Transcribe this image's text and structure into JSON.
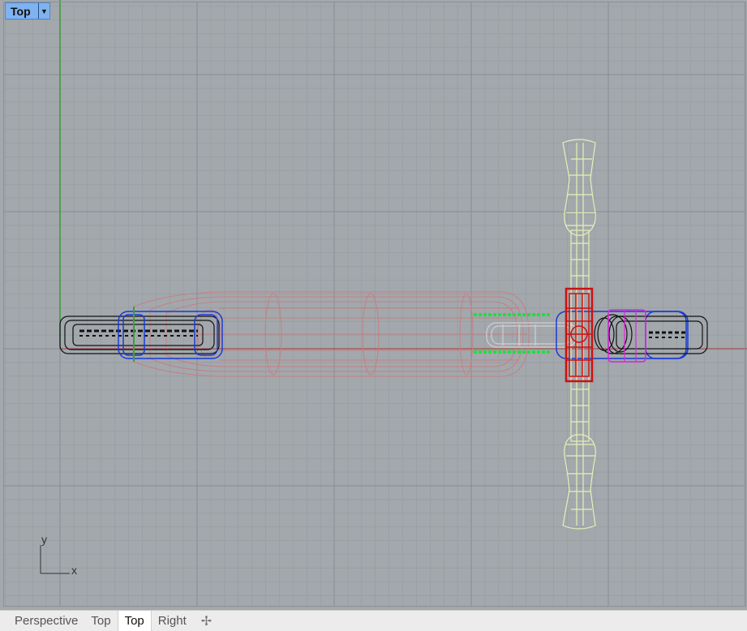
{
  "viewport": {
    "name": "Top",
    "dropdown_icon": "chevron-down-icon"
  },
  "axes": {
    "y_label": "y",
    "x_label": "x"
  },
  "colors": {
    "background": "#a3a8ad",
    "grid_minor": "#949aa0",
    "grid_major": "#868c92",
    "axis_x": "#a23a3a",
    "axis_y": "#3a9a3a",
    "deck": "#c48080",
    "handlebar": "#e6f0b4",
    "wheel": "#111111",
    "wheel_hub": "#1a3ad6",
    "fork": "#cc1111",
    "clamp": "#dd22dd",
    "brake": "#22dd44",
    "neck": "#d0d0d0"
  },
  "tabs": [
    {
      "label": "Perspective",
      "active": false
    },
    {
      "label": "Top",
      "active": false
    },
    {
      "label": "Top",
      "active": true
    },
    {
      "label": "Right",
      "active": false
    }
  ],
  "add_tab_icon": "plus-icon"
}
